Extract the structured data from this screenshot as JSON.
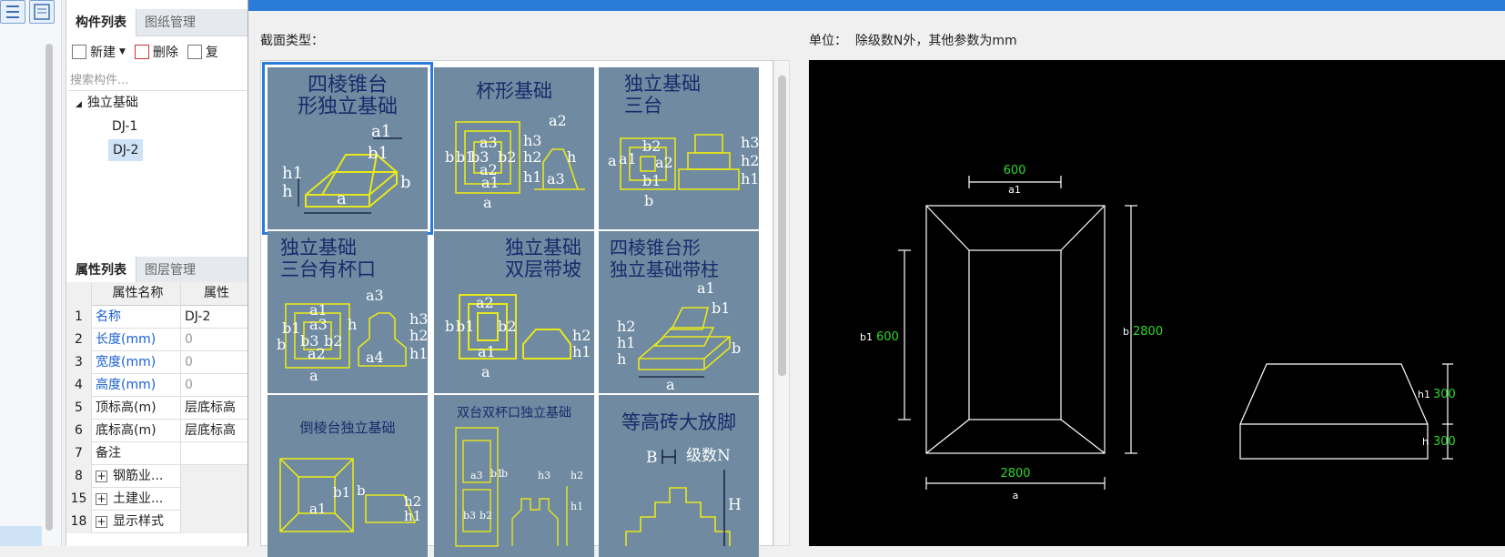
{
  "component_panel": {
    "tabs": [
      "构件列表",
      "图纸管理"
    ],
    "toolbar": {
      "new_label": "新建",
      "delete_label": "删除",
      "copy_label": "复"
    },
    "search_placeholder": "搜索构件...",
    "tree": {
      "root": "独立基础",
      "items": [
        "DJ-1",
        "DJ-2"
      ],
      "selected": "DJ-2"
    }
  },
  "property_panel": {
    "tabs": [
      "属性列表",
      "图层管理"
    ],
    "columns": [
      "属性名称",
      "属性"
    ],
    "rows": [
      {
        "num": "1",
        "name": "名称",
        "value": "DJ-2"
      },
      {
        "num": "2",
        "name": "长度(mm)",
        "value": "0"
      },
      {
        "num": "3",
        "name": "宽度(mm)",
        "value": "0"
      },
      {
        "num": "4",
        "name": "高度(mm)",
        "value": "0"
      },
      {
        "num": "5",
        "name": "顶标高(m)",
        "value": "层底标高"
      },
      {
        "num": "6",
        "name": "底标高(m)",
        "value": "层底标高"
      },
      {
        "num": "7",
        "name": "备注",
        "value": ""
      },
      {
        "num": "8",
        "name": "钢筋业...",
        "value": ""
      },
      {
        "num": "15",
        "name": "土建业...",
        "value": ""
      },
      {
        "num": "18",
        "name": "显示样式",
        "value": ""
      }
    ]
  },
  "dialog": {
    "section_type_label": "截面类型：",
    "unit_label": "单位：",
    "unit_text": "除级数N外，其他参数为mm",
    "thumbnails": [
      {
        "title": "四棱锥台\n形独立基础",
        "labels": [
          "a1",
          "b1",
          "h1",
          "h",
          "a",
          "b"
        ]
      },
      {
        "title": "杯形基础",
        "labels": [
          "a2",
          "b",
          "b1",
          "b3",
          "b2",
          "a3",
          "a2",
          "a1",
          "h3",
          "h2",
          "h1",
          "h",
          "a3",
          "a"
        ]
      },
      {
        "title": "独立基础\n三台",
        "labels": [
          "a",
          "a1",
          "b2",
          "a2",
          "b1",
          "b",
          "h3",
          "h2",
          "h1"
        ]
      },
      {
        "title": "独立基础\n三台有杯口",
        "labels": [
          "a1",
          "a3",
          "b1",
          "b",
          "b3",
          "b2",
          "a2",
          "a",
          "a3",
          "h",
          "a4",
          "h3",
          "h2",
          "h1"
        ]
      },
      {
        "title": "独立基础\n双层带坡",
        "labels": [
          "a2",
          "b",
          "b1",
          "b2",
          "a1",
          "a",
          "h2",
          "h1"
        ]
      },
      {
        "title": "四棱锥台形\n独立基础带柱",
        "labels": [
          "a1",
          "b1",
          "h2",
          "h1",
          "h",
          "a",
          "b"
        ]
      },
      {
        "title": "倒棱台独立基础",
        "labels": [
          "b1",
          "b",
          "a1",
          "h2",
          "h1"
        ]
      },
      {
        "title": "双台双杯口独立基础",
        "labels": [
          "a3",
          "b1",
          "b",
          "b3",
          "b2",
          "h3",
          "h2",
          "h1"
        ]
      },
      {
        "title": "等高砖大放脚",
        "labels": [
          "B",
          "级数N",
          "H"
        ]
      }
    ],
    "selected_index": 0
  },
  "preview": {
    "a1": {
      "label": "a1",
      "value": "600"
    },
    "b1": {
      "label": "b1",
      "value": "600"
    },
    "b": {
      "label": "b",
      "value": "2800"
    },
    "a": {
      "label": "a",
      "value": "2800"
    },
    "h1": {
      "label": "h1",
      "value": "300"
    },
    "h": {
      "label": "h",
      "value": "300"
    }
  },
  "colors": {
    "accent": "#2b7bd8",
    "thumb_bg": "#6f8aa1",
    "dim_green": "#2bd92b"
  }
}
